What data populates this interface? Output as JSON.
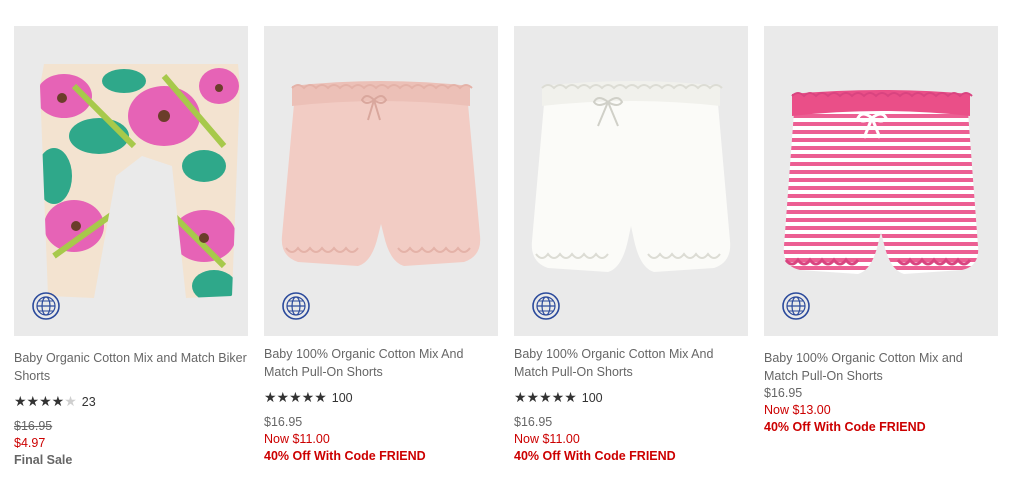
{
  "products": [
    {
      "name": "Baby Organic Cotton Mix and Match Biker Shorts",
      "rating_stars": 4,
      "review_count": "23",
      "original_price": "$16.95",
      "sale_price": "$4.97",
      "final_sale": "Final Sale",
      "image_icon": "globe-icon"
    },
    {
      "name": "Baby 100% Organic Cotton Mix And Match Pull-On Shorts",
      "rating_stars": 5,
      "review_count": "100",
      "original_price": "$16.95",
      "sale_price": "Now $11.00",
      "promo": "40% Off With Code FRIEND",
      "image_icon": "globe-icon"
    },
    {
      "name": "Baby 100% Organic Cotton Mix And Match Pull-On Shorts",
      "rating_stars": 5,
      "review_count": "100",
      "original_price": "$16.95",
      "sale_price": "Now $11.00",
      "promo": "40% Off With Code FRIEND",
      "image_icon": "globe-icon"
    },
    {
      "name": "Baby 100% Organic Cotton Mix and Match Pull-On Shorts",
      "original_price": "$16.95",
      "sale_price": "Now $13.00",
      "promo": "40% Off With Code FRIEND",
      "image_icon": "globe-icon"
    }
  ],
  "colors": {
    "sale_red": "#cc0000",
    "text_gray": "#666666",
    "image_bg": "#eaeaea",
    "globe_blue": "#2b4a9c"
  }
}
